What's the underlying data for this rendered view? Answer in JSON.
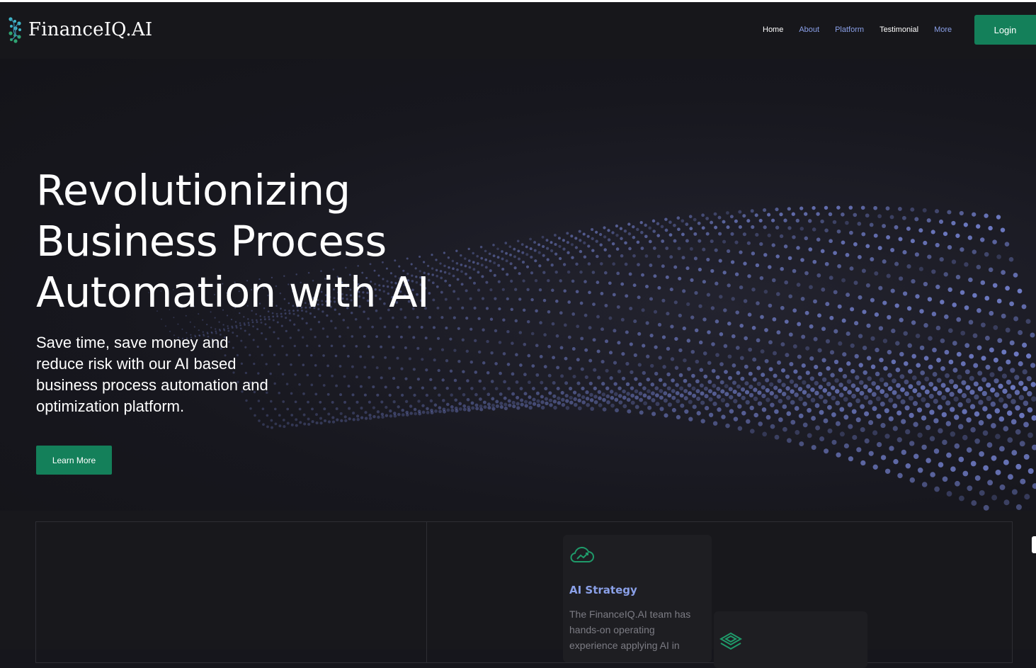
{
  "brand": {
    "name": "FinanceIQ.AI",
    "logo_icon": "dna-helix-icon",
    "colors": {
      "accent_green": "#14805a",
      "link_blue": "#8aa0e8",
      "background": "#16161c"
    }
  },
  "nav": {
    "items": [
      {
        "label": "Home",
        "style": "white"
      },
      {
        "label": "About",
        "style": "blue"
      },
      {
        "label": "Platform",
        "style": "blue"
      },
      {
        "label": "Testimonial",
        "style": "white"
      },
      {
        "label": "More",
        "style": "blue"
      }
    ],
    "login_label": "Login"
  },
  "hero": {
    "title": "Revolutionizing\nBusiness Process\nAutomation with AI",
    "subtitle": "Save time, save money and reduce risk with our AI based business process automation and optimization platform.",
    "cta_label": "Learn More"
  },
  "features": {
    "cards": [
      {
        "icon": "cloud-chart-icon",
        "title": "AI Strategy",
        "text": "The FinanceIQ.AI team has hands-on operating experience applying AI in"
      },
      {
        "icon": "layers-diamond-icon"
      }
    ]
  }
}
